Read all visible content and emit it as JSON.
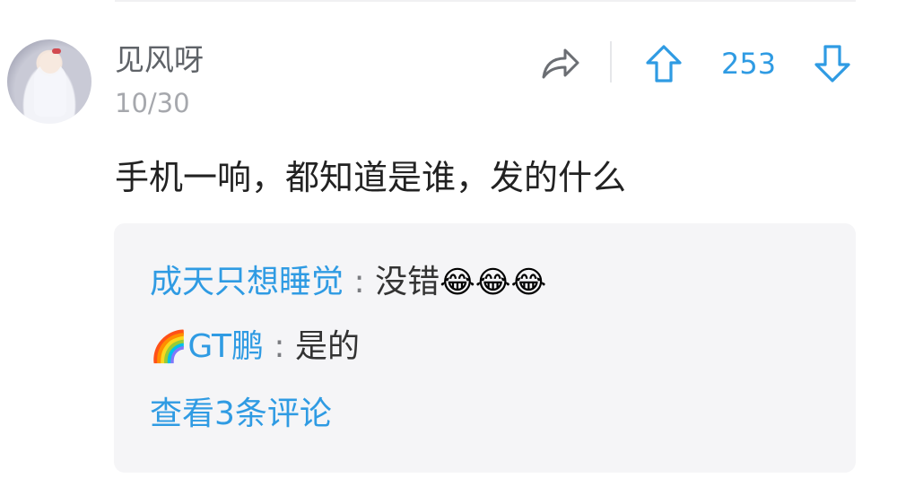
{
  "comment": {
    "username": "见风呀",
    "date": "10/30",
    "vote_count": "253",
    "content": "手机一响，都知道是谁，发的什么"
  },
  "replies": [
    {
      "author": "成天只想睡觉",
      "separator": ":",
      "text": "没错",
      "emoji": "😂😂😂"
    },
    {
      "author_emoji": "🌈",
      "author": "GT鹏",
      "separator": ":",
      "text": "是的"
    }
  ],
  "view_more_label": "查看3条评论",
  "icons": {
    "share": "share-arrow-icon",
    "upvote": "arrow-up-icon",
    "downvote": "arrow-down-icon"
  },
  "colors": {
    "accent": "#2f9be3",
    "reply_bg": "#f5f5f7"
  }
}
